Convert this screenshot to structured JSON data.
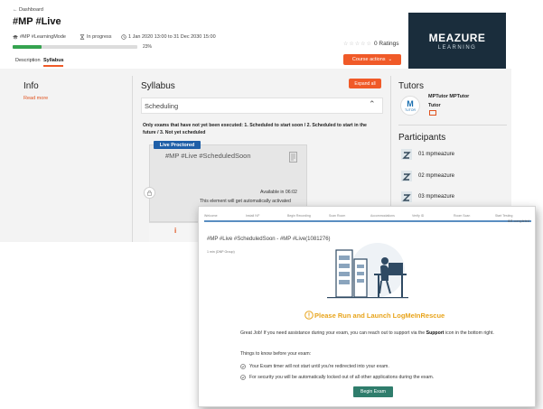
{
  "course": {
    "back_label": "← Dashboard",
    "title": "#MP #Live",
    "tag": "#MP #LearningMode",
    "status": "In progress",
    "dates": "1 Jan 2020 13:00 to 31 Dec 2030 15:00",
    "progress": 23,
    "progress_label": "23%",
    "tabs": [
      "Description",
      "Syllabus"
    ],
    "active_tab": "Syllabus",
    "stars": "☆☆☆☆☆",
    "ratings": "0 Ratings",
    "course_actions_label": "Course actions",
    "logo_main": "MEAZURE",
    "logo_sub": "LEARNING",
    "colors": {
      "accent": "#f05a28",
      "progress": "#35a34f",
      "badge": "#1e5fa8",
      "logo_bg": "#1a2d3c"
    }
  },
  "info": {
    "heading": "Info",
    "read_more": "Read more"
  },
  "syllabus": {
    "heading": "Syllabus",
    "expand_all": "Expand all",
    "section": "Scheduling",
    "note": "Only exams that have not yet been executed: 1. Scheduled to start soon / 2. Scheduled to start in the future / 3. Not yet scheduled",
    "exam": {
      "badge": "Live Proctored",
      "title": "#MP #Live #ScheduledSoon",
      "available": "Available in 06:02",
      "auto_activated": "This element will get automatically activated",
      "info_icon": "info-icon"
    }
  },
  "tutors": {
    "heading": "Tutors",
    "avatar_letter": "M",
    "avatar_text": "TUTOR",
    "name": "MPTutor MPTutor",
    "role": "Tutor"
  },
  "participants": {
    "heading": "Participants",
    "items": [
      "01 mpmeazure",
      "02 mpmeazure",
      "03 mpmeazure"
    ]
  },
  "exam_window": {
    "steps": [
      "Welcome",
      "Install IVF",
      "Begin Recording",
      "Scan Room",
      "Accommodations",
      "Verify ID",
      "Room Scan",
      "Start Testing"
    ],
    "completed": "8/8 completed",
    "title": "#MP #Live #ScheduledSoon - #MP #Live(1081276)",
    "subtitle": "1 min (DNP Group)",
    "warn_title": "Please Run and Launch LogMeInRescue",
    "para_start": "Great Job! If you need assistance during your exam, you can reach out to support via the ",
    "para_bold": "Support",
    "para_end": " icon in the bottom right.",
    "things_label": "Things to know before your exam:",
    "checks": [
      "Your Exam timer will not start until you're redirected into your exam.",
      "For security you will be automatically locked out of all other applications during the exam."
    ],
    "begin_label": "Begin Exam",
    "colors": {
      "warn": "#e8a41c",
      "button": "#2f7d6c",
      "steps": "#5a8ec1"
    }
  }
}
